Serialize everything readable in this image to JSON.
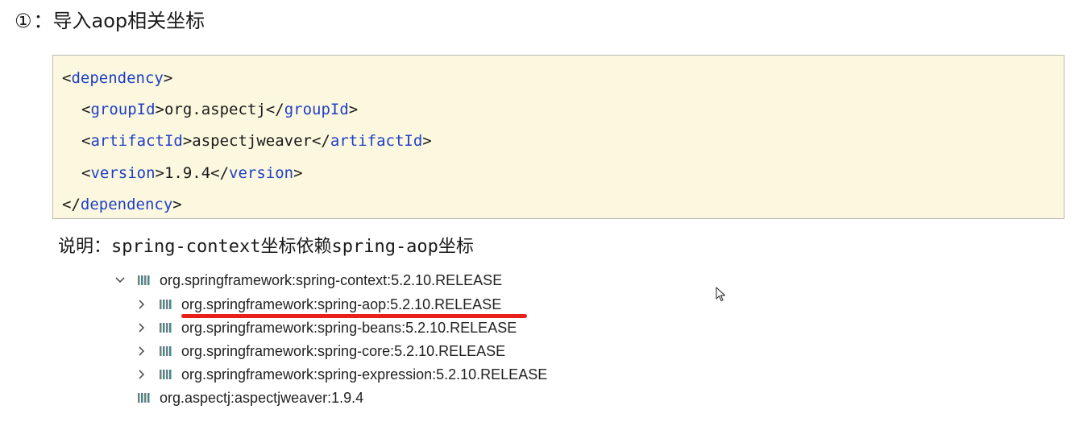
{
  "heading": {
    "number": "①",
    "text": "：导入aop相关坐标"
  },
  "code": {
    "line1": {
      "open": "<",
      "tag": "dependency",
      "close": ">"
    },
    "line2": {
      "open": "<",
      "tag": "groupId",
      "mid": ">org.aspectj</",
      "tag2": "groupId",
      "close": ">"
    },
    "line3": {
      "open": "<",
      "tag": "artifactId",
      "mid": ">aspectjweaver</",
      "tag2": "artifactId",
      "close": ">"
    },
    "line4": {
      "open": "<",
      "tag": "version",
      "mid": ">1.9.4</",
      "tag2": "version",
      "close": ">"
    },
    "line5": {
      "open": "</",
      "tag": "dependency",
      "close": ">"
    }
  },
  "note": {
    "prefix": "说明：",
    "part1": "spring-context",
    "part2": "坐标依赖",
    "part3": "spring-aop",
    "part4": "坐标"
  },
  "tree": {
    "items": [
      {
        "label": "org.springframework:spring-context:5.2.10.RELEASE",
        "expanded": true
      },
      {
        "label": "org.springframework:spring-aop:5.2.10.RELEASE",
        "expanded": false,
        "highlighted": true
      },
      {
        "label": "org.springframework:spring-beans:5.2.10.RELEASE",
        "expanded": false
      },
      {
        "label": "org.springframework:spring-core:5.2.10.RELEASE",
        "expanded": false
      },
      {
        "label": "org.springframework:spring-expression:5.2.10.RELEASE",
        "expanded": false
      },
      {
        "label": "org.aspectj:aspectjweaver:1.9.4"
      }
    ]
  },
  "colors": {
    "code_background": "#fbf8df",
    "tag": "#1f3fc4",
    "underline": "#e8201a",
    "icon_teal": "#3d8a8f",
    "icon_gray": "#7a7a7a"
  }
}
